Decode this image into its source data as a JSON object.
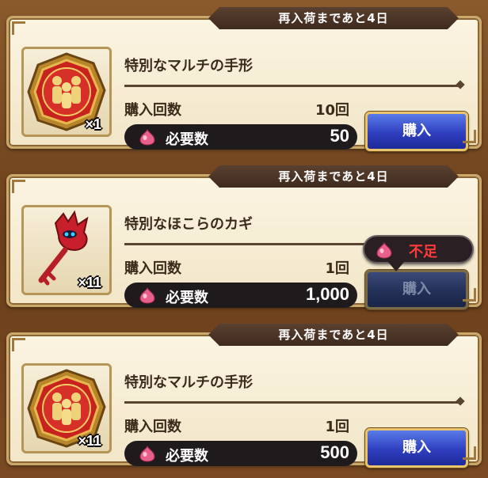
{
  "cards": [
    {
      "restock": "再入荷まであと4日",
      "name": "特別なマルチの手形",
      "icon": "multi-seal-icon",
      "quantity": "×1",
      "count_label": "購入回数",
      "count_value": "10回",
      "cost_label": "必要数",
      "cost_value": "50",
      "buy_label": "購入",
      "buy_enabled": true
    },
    {
      "restock": "再入荷まであと4日",
      "name": "特別なほこらのカギ",
      "icon": "shrine-key-icon",
      "quantity": "×11",
      "count_label": "購入回数",
      "count_value": "1回",
      "cost_label": "必要数",
      "cost_value": "1,000",
      "buy_label": "購入",
      "buy_enabled": false,
      "insufficient_label": "不足"
    },
    {
      "restock": "再入荷まであと4日",
      "name": "特別なマルチの手形",
      "icon": "multi-seal-icon",
      "quantity": "×11",
      "count_label": "購入回数",
      "count_value": "1回",
      "cost_label": "必要数",
      "cost_value": "500",
      "buy_label": "購入",
      "buy_enabled": true
    }
  ],
  "colors": {
    "buy_button": "#2f3fbf",
    "cost_bar": "#1f1a1c",
    "insufficient_text": "#ff3a3a",
    "card_bg": "#f2e6c8"
  }
}
